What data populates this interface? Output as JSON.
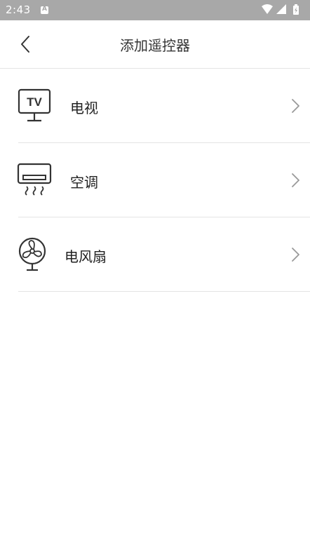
{
  "status_bar": {
    "time": "2:43",
    "notification_icon": "a-icon",
    "wifi_icon": "wifi-icon",
    "signal_icon": "signal-icon",
    "battery_icon": "battery-icon"
  },
  "app_bar": {
    "back_icon": "back-chevron-icon",
    "title": "添加遥控器"
  },
  "devices": [
    {
      "label": "电视",
      "icon": "tv-icon"
    },
    {
      "label": "空调",
      "icon": "air-conditioner-icon"
    },
    {
      "label": "电风扇",
      "icon": "fan-icon"
    }
  ],
  "colors": {
    "status_bar_bg": "#a8a8a8",
    "divider": "#e4e4e4",
    "icon_stroke": "#333333",
    "chevron": "#999999"
  }
}
